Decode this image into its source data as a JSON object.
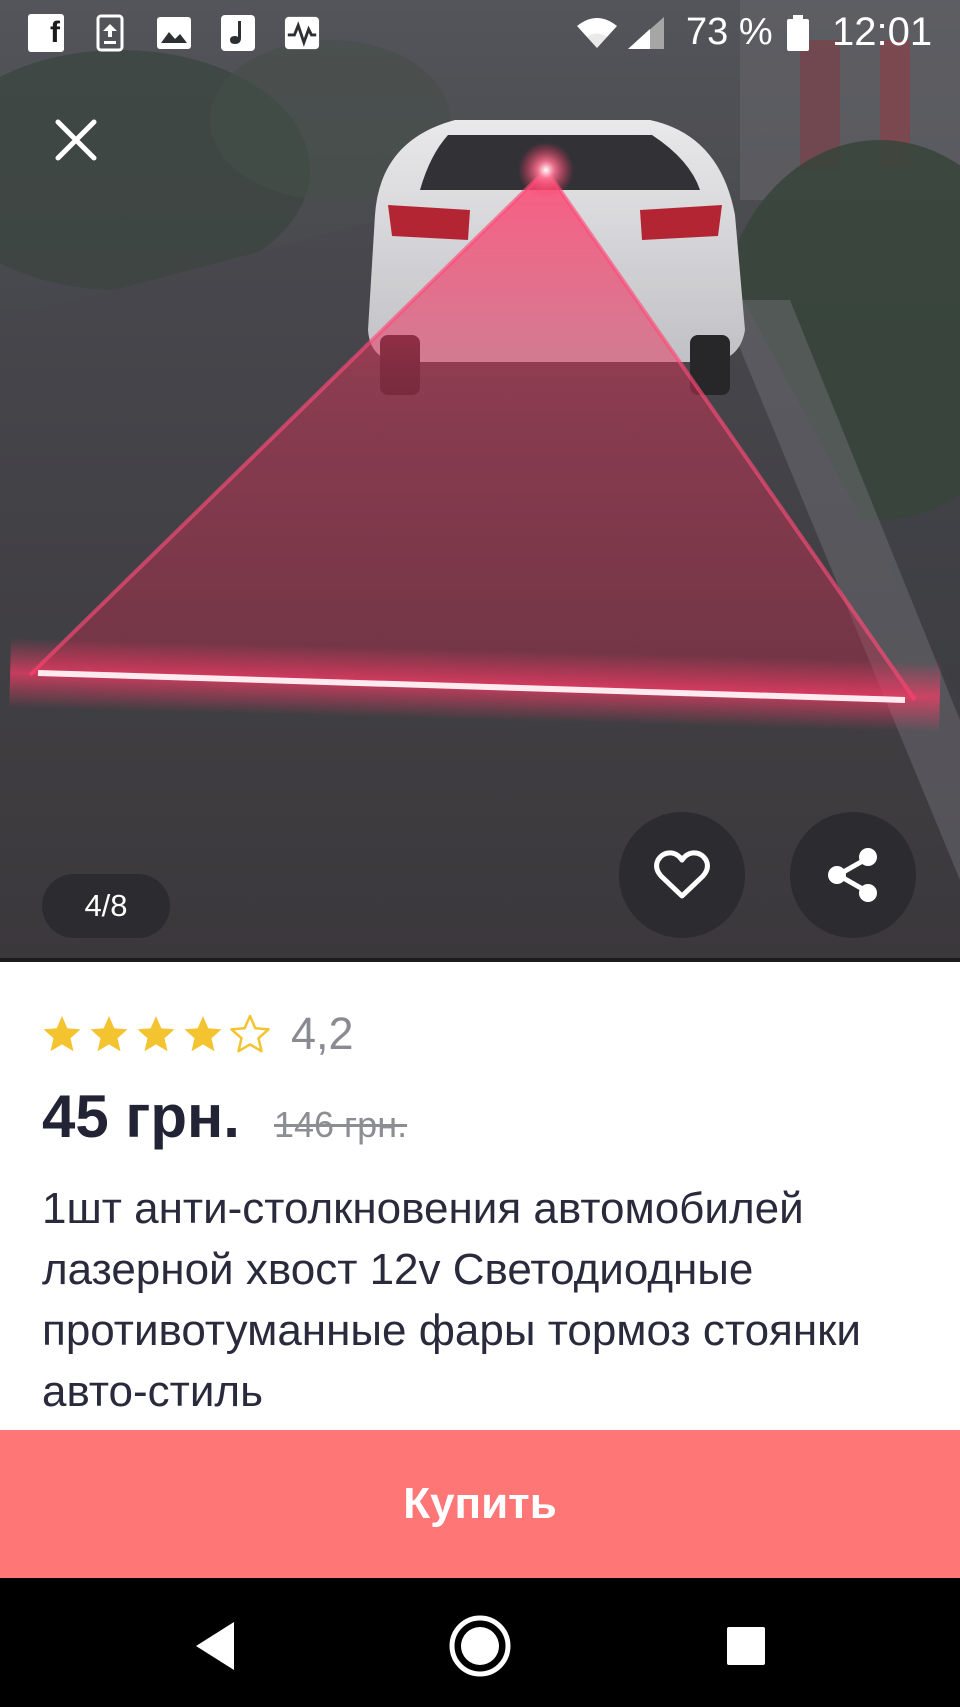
{
  "status_bar": {
    "battery_percent": "73 %",
    "time": "12:01",
    "icons": [
      "facebook-icon",
      "upload-icon",
      "gallery-icon",
      "music-icon",
      "activity-icon",
      "wifi-icon",
      "signal-icon",
      "battery-icon"
    ]
  },
  "gallery": {
    "counter": "4/8"
  },
  "product": {
    "rating": "4,2",
    "rating_stars": 4.2,
    "price": "45 грн.",
    "old_price": "146 грн.",
    "title": "1шт анти-столкновения автомобилей лазерной хвост 12v Светодиодные противотуманные фары тормоз стоянки авто-стиль"
  },
  "actions": {
    "buy_label": "Купить"
  },
  "colors": {
    "buy_button": "#ff7676",
    "star_filled": "#f4c430",
    "price_text": "#232336",
    "nav_bar": "#000000"
  }
}
